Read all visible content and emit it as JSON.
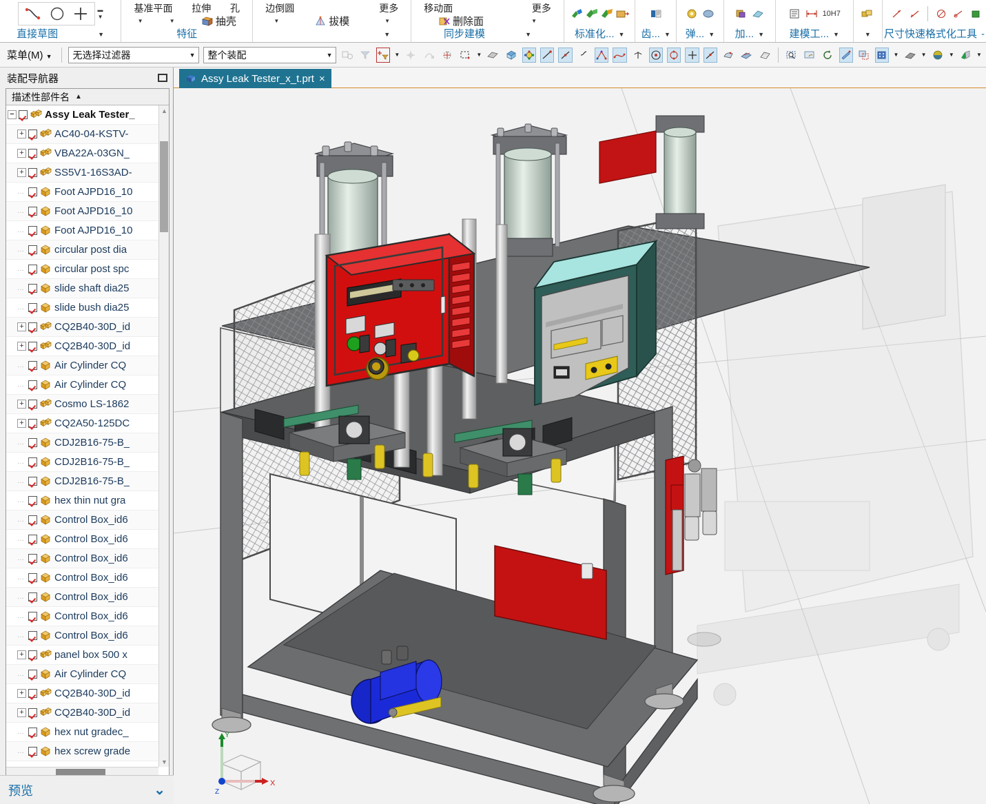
{
  "app": {
    "window_title": "Assy Leak Tester_x_t.prt",
    "accent": "#1a6fa8",
    "tab_active_bg": "#1f7391"
  },
  "ribbon": {
    "groups": [
      {
        "name": "direct-sketch",
        "label": "直接草图",
        "commands": [
          {
            "icon": "spline-icon",
            "label": ""
          },
          {
            "icon": "circle-icon",
            "label": ""
          },
          {
            "icon": "plus-icon",
            "label": ""
          }
        ]
      },
      {
        "name": "feature",
        "label": "特征",
        "top_labels": [
          "基准平面",
          "拉伸",
          "孔"
        ],
        "commands": [
          {
            "icon": "shell-icon",
            "label": "抽壳"
          }
        ]
      },
      {
        "name": "detail-feature",
        "label": "",
        "top_labels": [
          "边倒圆",
          "更多"
        ],
        "commands": [
          {
            "icon": "draft-icon",
            "label": "拔模"
          }
        ]
      },
      {
        "name": "synchronous-modeling",
        "label": "同步建模",
        "top_labels": [
          "移动面",
          "更多"
        ],
        "commands": [
          {
            "icon": "delete-face-icon",
            "label": "删除面"
          }
        ]
      },
      {
        "name": "standardization",
        "label": "标准化..."
      },
      {
        "name": "gear",
        "label": "齿..."
      },
      {
        "name": "spring",
        "label": "弹..."
      },
      {
        "name": "add",
        "label": "加..."
      },
      {
        "name": "modeling-tools",
        "label": "建模工..."
      },
      {
        "name": "misc",
        "label": ""
      },
      {
        "name": "dimension-format-tools",
        "label": "尺寸快速格式化工具"
      }
    ],
    "tolerance_tag": "10H7"
  },
  "selection_bar": {
    "menu_label": "菜单(M)",
    "menu_mnemonic": "M",
    "filter_value": "无选择过滤器",
    "scope_value": "整个装配",
    "dropdown_arrow": "▼",
    "icons": [
      "select-general-icon",
      "filter-icon",
      "selection-priority-icon",
      "snap-point-icon",
      "snap-curve-icon",
      "point-constructor-icon",
      "rectangle-select-icon",
      "face-select-icon",
      "solid-select-icon",
      "quadrant-point-icon",
      "endpoint-icon",
      "midpoint-icon",
      "tangent-icon",
      "intersection-icon",
      "curve-point-icon",
      "control-point-icon",
      "arc-center-icon",
      "arc-quadrant-icon",
      "existing-point-icon",
      "point-on-curve-icon",
      "point-on-face-icon",
      "between-points-icon",
      "zoom-icon",
      "pan-icon",
      "rotate-icon",
      "fit-icon",
      "clip-icon",
      "orient-view-icon",
      "shaded-edges-icon",
      "render-style-icon",
      "background-icon"
    ]
  },
  "assembly_navigator": {
    "title": "装配导航器",
    "column_header": "描述性部件名",
    "sort_indicator": "▲",
    "preview_label": "预览",
    "preview_chevron": "⌄",
    "items": [
      {
        "label": "Assy Leak Tester_",
        "depth": 0,
        "expander": "−",
        "type": "assembly",
        "root": true
      },
      {
        "label": "AC40-04-KSTV-",
        "depth": 1,
        "expander": "+",
        "type": "assembly"
      },
      {
        "label": "VBA22A-03GN_",
        "depth": 1,
        "expander": "+",
        "type": "assembly"
      },
      {
        "label": "SS5V1-16S3AD-",
        "depth": 1,
        "expander": "+",
        "type": "assembly"
      },
      {
        "label": "Foot AJPD16_10",
        "depth": 1,
        "expander": "",
        "type": "part"
      },
      {
        "label": "Foot AJPD16_10",
        "depth": 1,
        "expander": "",
        "type": "part"
      },
      {
        "label": "Foot AJPD16_10",
        "depth": 1,
        "expander": "",
        "type": "part"
      },
      {
        "label": "circular post dia",
        "depth": 1,
        "expander": "",
        "type": "part"
      },
      {
        "label": "circular post spc",
        "depth": 1,
        "expander": "",
        "type": "part"
      },
      {
        "label": "slide shaft dia25",
        "depth": 1,
        "expander": "",
        "type": "part"
      },
      {
        "label": "slide bush dia25",
        "depth": 1,
        "expander": "",
        "type": "part"
      },
      {
        "label": "CQ2B40-30D_id",
        "depth": 1,
        "expander": "+",
        "type": "assembly"
      },
      {
        "label": "CQ2B40-30D_id",
        "depth": 1,
        "expander": "+",
        "type": "assembly"
      },
      {
        "label": "Air Cylinder CQ",
        "depth": 1,
        "expander": "",
        "type": "part"
      },
      {
        "label": "Air Cylinder CQ",
        "depth": 1,
        "expander": "",
        "type": "part"
      },
      {
        "label": "Cosmo LS-1862",
        "depth": 1,
        "expander": "+",
        "type": "assembly"
      },
      {
        "label": "CQ2A50-125DC",
        "depth": 1,
        "expander": "+",
        "type": "assembly"
      },
      {
        "label": "CDJ2B16-75-B_",
        "depth": 1,
        "expander": "",
        "type": "part"
      },
      {
        "label": "CDJ2B16-75-B_",
        "depth": 1,
        "expander": "",
        "type": "part"
      },
      {
        "label": "CDJ2B16-75-B_",
        "depth": 1,
        "expander": "",
        "type": "part"
      },
      {
        "label": "hex thin nut gra",
        "depth": 1,
        "expander": "",
        "type": "part"
      },
      {
        "label": "Control Box_id6",
        "depth": 1,
        "expander": "",
        "type": "part"
      },
      {
        "label": "Control Box_id6",
        "depth": 1,
        "expander": "",
        "type": "part"
      },
      {
        "label": "Control Box_id6",
        "depth": 1,
        "expander": "",
        "type": "part"
      },
      {
        "label": "Control Box_id6",
        "depth": 1,
        "expander": "",
        "type": "part"
      },
      {
        "label": "Control Box_id6",
        "depth": 1,
        "expander": "",
        "type": "part"
      },
      {
        "label": "Control Box_id6",
        "depth": 1,
        "expander": "",
        "type": "part"
      },
      {
        "label": "Control Box_id6",
        "depth": 1,
        "expander": "",
        "type": "part"
      },
      {
        "label": "panel box 500 x",
        "depth": 1,
        "expander": "+",
        "type": "assembly"
      },
      {
        "label": "Air Cylinder CQ",
        "depth": 1,
        "expander": "",
        "type": "part"
      },
      {
        "label": "CQ2B40-30D_id",
        "depth": 1,
        "expander": "+",
        "type": "assembly"
      },
      {
        "label": "CQ2B40-30D_id",
        "depth": 1,
        "expander": "+",
        "type": "assembly"
      },
      {
        "label": "hex nut gradec_",
        "depth": 1,
        "expander": "",
        "type": "part"
      },
      {
        "label": "hex screw grade",
        "depth": 1,
        "expander": "",
        "type": "part"
      }
    ]
  },
  "graphics": {
    "model_name": "Assy Leak Tester",
    "background": "#f2f2f2",
    "triad": {
      "x_label": "X",
      "y_label": "Y",
      "z_label": "Z",
      "x_color": "#cc2222",
      "y_color": "#118833",
      "z_color": "#1144cc"
    },
    "colors": {
      "frame_dark": "#58595b",
      "panel_light": "#e8e8e8",
      "control_box_red": "#d01010",
      "tester_teal": "#9fe0de",
      "pump_blue": "#1a2ad6",
      "guard_mesh": "#7d7f82"
    }
  }
}
